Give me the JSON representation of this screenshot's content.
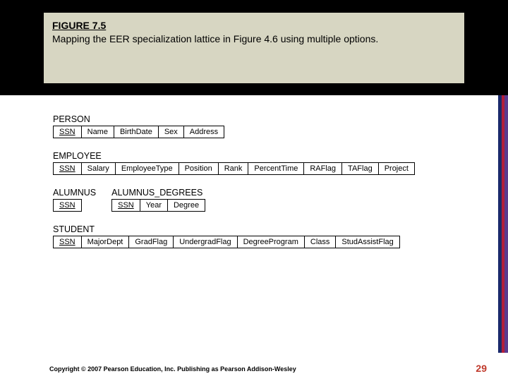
{
  "header": {
    "figure_label": "FIGURE 7.5",
    "caption": "Mapping the EER specialization lattice in Figure 4.6 using multiple options."
  },
  "schemas": {
    "person": {
      "title": "PERSON",
      "cols": [
        "SSN",
        "Name",
        "BirthDate",
        "Sex",
        "Address"
      ]
    },
    "employee": {
      "title": "EMPLOYEE",
      "cols": [
        "SSN",
        "Salary",
        "EmployeeType",
        "Position",
        "Rank",
        "PercentTime",
        "RAFlag",
        "TAFlag",
        "Project"
      ]
    },
    "alumnus": {
      "title": "ALUMNUS",
      "cols": [
        "SSN"
      ]
    },
    "alumnus_degrees": {
      "title": "ALUMNUS_DEGREES",
      "cols": [
        "SSN",
        "Year",
        "Degree"
      ]
    },
    "student": {
      "title": "STUDENT",
      "cols": [
        "SSN",
        "MajorDept",
        "GradFlag",
        "UndergradFlag",
        "DegreeProgram",
        "Class",
        "StudAssistFlag"
      ]
    }
  },
  "footer": {
    "copyright": "Copyright © 2007 Pearson Education, Inc. Publishing as Pearson Addison-Wesley",
    "page": "29"
  }
}
